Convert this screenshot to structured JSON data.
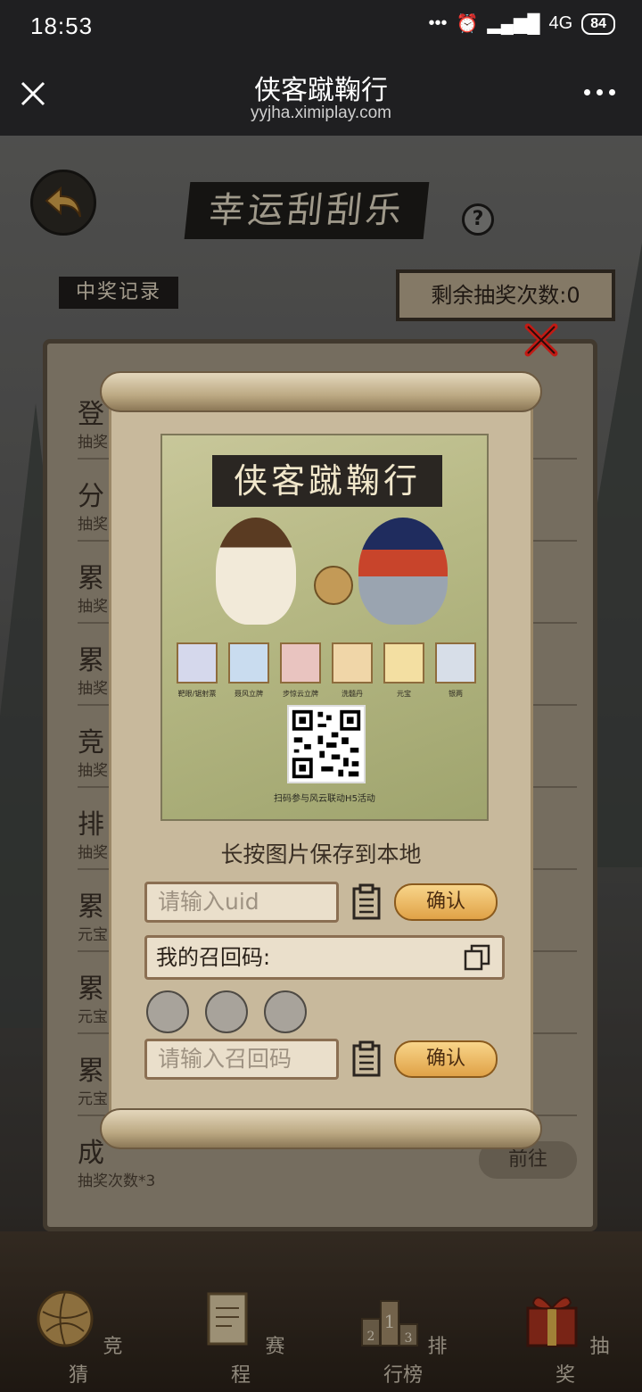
{
  "status": {
    "time": "18:53",
    "network": "4G",
    "battery": "84"
  },
  "nav": {
    "title": "侠客蹴鞠行",
    "url": "yyjha.ximiplay.com"
  },
  "game": {
    "title": "幸运刮刮乐",
    "help": "?",
    "record_label": "中奖记录",
    "remaining_label": "剩余抽奖次数:0"
  },
  "tasks": [
    {
      "title": "登",
      "sub": "抽奖"
    },
    {
      "title": "分",
      "sub": "抽奖"
    },
    {
      "title": "累",
      "sub": "抽奖"
    },
    {
      "title": "累",
      "sub": "抽奖"
    },
    {
      "title": "竞",
      "sub": "抽奖"
    },
    {
      "title": "排",
      "sub": "抽奖"
    },
    {
      "title": "累",
      "sub": "元宝"
    },
    {
      "title": "累",
      "sub": "元宝"
    },
    {
      "title": "累",
      "sub": "元宝"
    },
    {
      "title": "成",
      "sub": "抽奖次数*3",
      "button": "前往"
    }
  ],
  "tabs": [
    "竞猜",
    "赛程",
    "排行榜",
    "抽奖"
  ],
  "modal": {
    "poster_title": "侠客蹴鞠行",
    "items": [
      "靶眼/锯射票",
      "聂风立牌",
      "步惊云立牌",
      "洗髓丹",
      "元宝",
      "银两"
    ],
    "poster_caption": "扫码参与风云联动H5活动",
    "save_tip": "长按图片保存到本地",
    "uid_placeholder": "请输入uid",
    "confirm": "确认",
    "my_code_label": "我的召回码:",
    "recall_placeholder": "请输入召回码"
  }
}
